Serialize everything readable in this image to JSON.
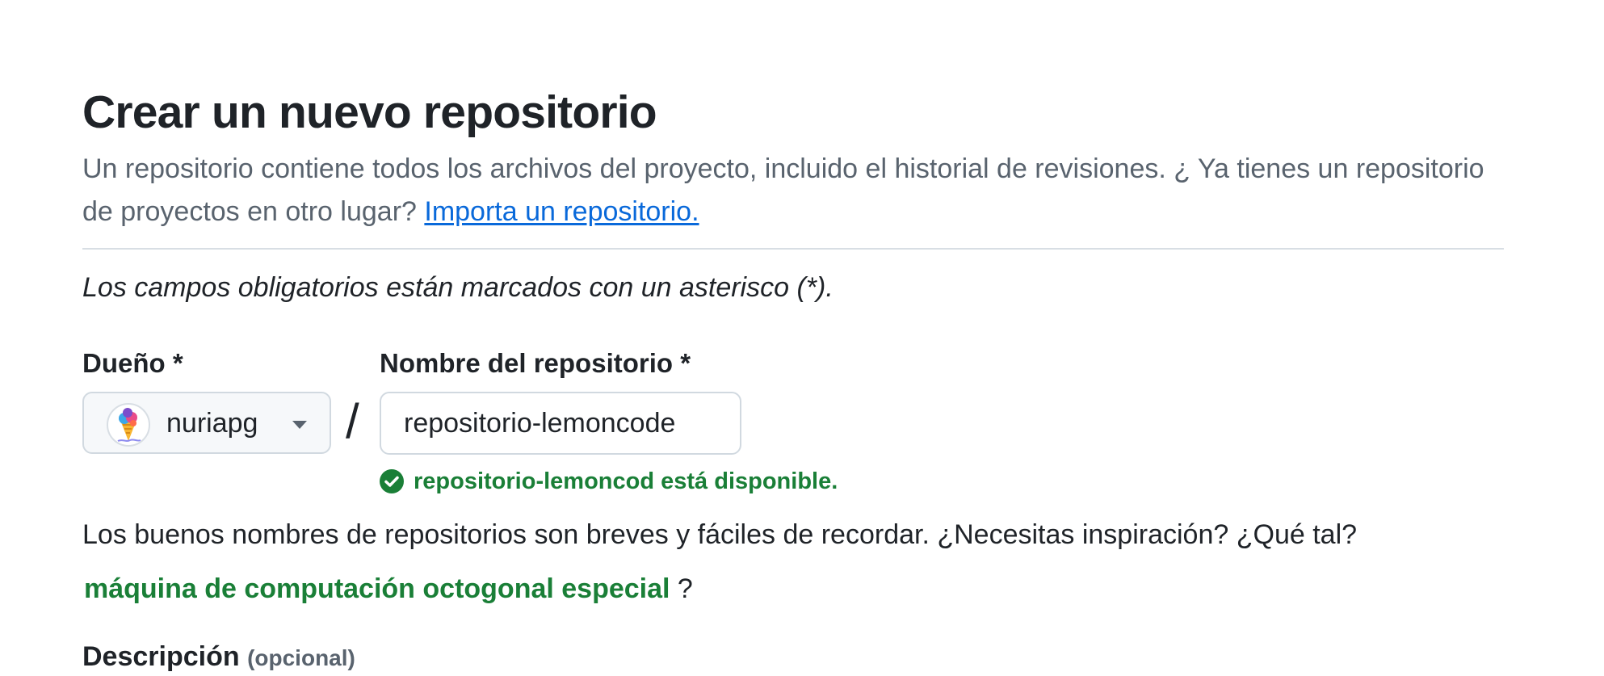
{
  "page": {
    "title": "Crear un nuevo repositorio",
    "intro_text": "Un repositorio contiene todos los archivos del proyecto, incluido el historial de revisiones. ¿ Ya tienes un repositorio de proyectos en otro lugar? ",
    "import_link": "Importa un repositorio.",
    "required_note": "Los campos obligatorios están marcados con un asterisco (*)."
  },
  "owner": {
    "label": "Dueño *",
    "value": "nuriapg",
    "avatar_icon": "ice-cream-avatar-icon",
    "dropdown_icon": "caret-down-icon"
  },
  "separator": "/",
  "repository": {
    "label": "Nombre del repositorio *",
    "value": "repositorio-lemoncode",
    "availability_icon": "check-circle-icon",
    "availability_text": "repositorio-lemoncod está disponible."
  },
  "hint": {
    "text": "Los buenos nombres de repositorios son breves y fáciles de recordar. ¿Necesitas inspiración? ¿Qué tal?",
    "suggestion": "máquina de computación octogonal especial",
    "suffix": " ?"
  },
  "description": {
    "label": "Descripción",
    "optional": "(opcional)"
  },
  "colors": {
    "text": "#1f2328",
    "muted": "#59636e",
    "link": "#0969da",
    "success": "#1a7f37",
    "border": "#d1d9e0"
  }
}
